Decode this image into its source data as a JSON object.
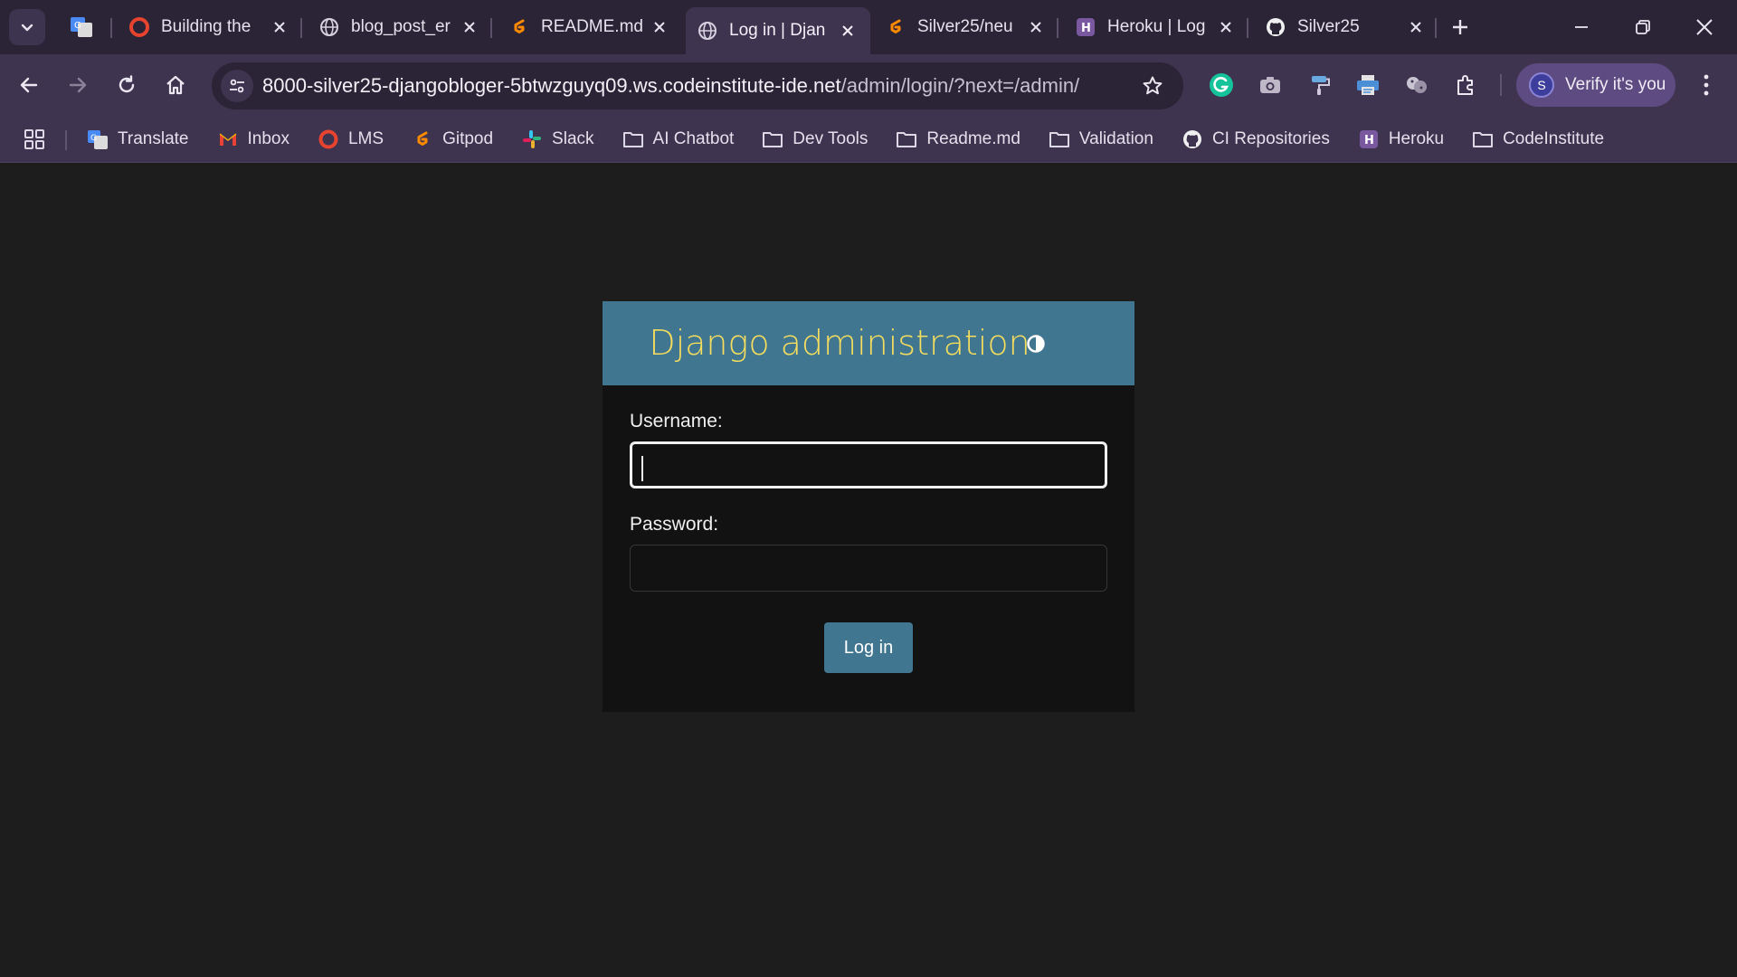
{
  "browser": {
    "tabs": [
      {
        "title": "Building the"
      },
      {
        "title": "blog_post_er"
      },
      {
        "title": "README.md"
      },
      {
        "title": "Log in | Djan"
      },
      {
        "title": "Silver25/neu"
      },
      {
        "title": "Heroku | Log"
      },
      {
        "title": "Silver25"
      }
    ],
    "address_bar": {
      "host": "8000-silver25-djangobloger-5btwzguyq09.ws.codeinstitute-ide.net",
      "path": "/admin/login/?next=/admin/"
    },
    "profile": {
      "initial": "S",
      "label": "Verify it's you"
    },
    "bookmarks": [
      {
        "label": "Translate"
      },
      {
        "label": "Inbox"
      },
      {
        "label": "LMS"
      },
      {
        "label": "Gitpod"
      },
      {
        "label": "Slack"
      },
      {
        "label": "AI Chatbot"
      },
      {
        "label": "Dev Tools"
      },
      {
        "label": "Readme.md"
      },
      {
        "label": "Validation"
      },
      {
        "label": "CI Repositories"
      },
      {
        "label": "Heroku"
      },
      {
        "label": "CodeInstitute"
      }
    ]
  },
  "login": {
    "site_name": "Django administration",
    "username_label": "Username:",
    "username_value": "",
    "password_label": "Password:",
    "password_value": "",
    "submit_label": "Log in"
  },
  "colors": {
    "django_header": "#417690",
    "django_title": "#f5dd5d",
    "page_bg": "#1d1d1d",
    "card_bg": "#121212",
    "chrome_frame": "#2a2436",
    "chrome_toolbar": "#3f3450"
  }
}
